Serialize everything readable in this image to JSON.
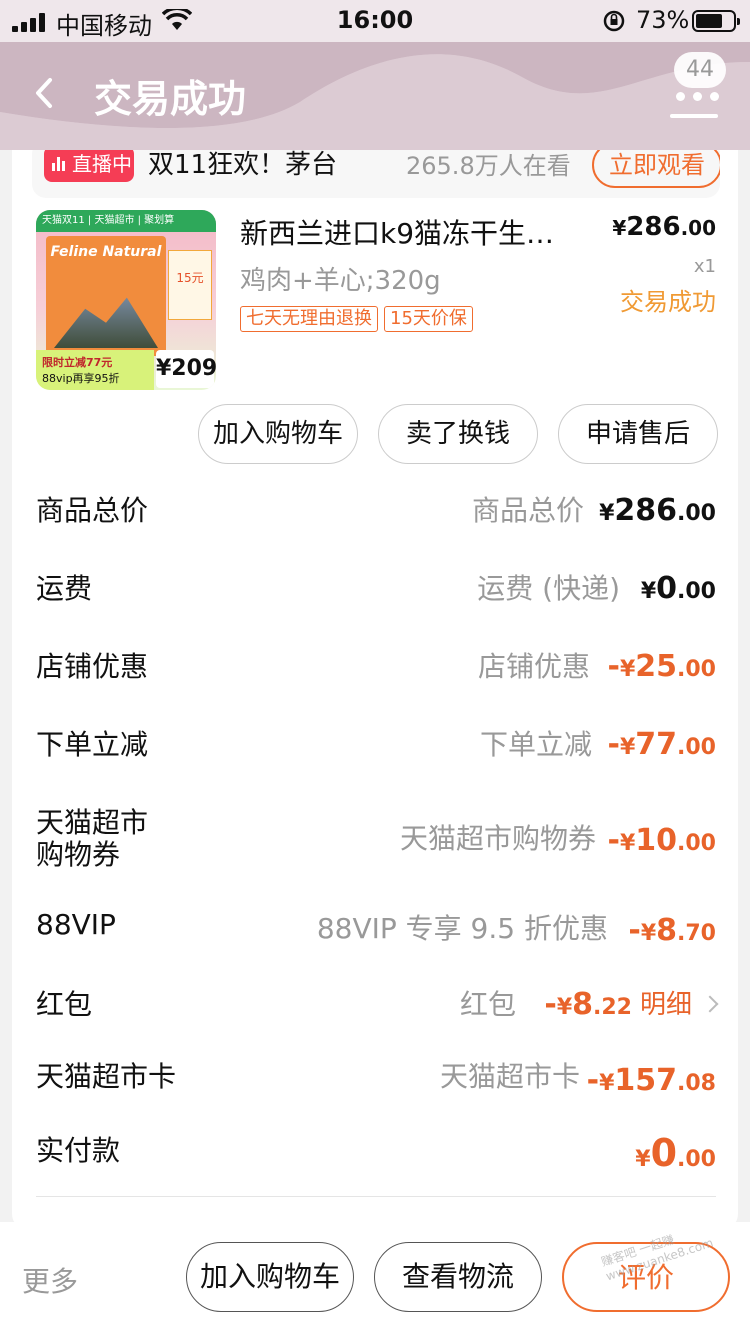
{
  "status_bar": {
    "carrier": "中国移动",
    "time": "16:00",
    "battery_percent": "73%",
    "battery_level": 0.73
  },
  "header": {
    "title": "交易成功",
    "badge_count": "44"
  },
  "live": {
    "tag": "直播中",
    "title": "双11狂欢！茅台",
    "viewers": "265.8万人在看",
    "watch_button": "立即观看"
  },
  "product": {
    "name": "新西兰进口k9猫冻干生…",
    "price_currency": "¥",
    "price_int": "286",
    "price_dec": ".00",
    "spec": "鸡肉+羊心;320g",
    "quantity": "x1",
    "status": "交易成功",
    "tags": [
      "七天无理由退换",
      "15天价保"
    ],
    "thumbnail": {
      "banner": "天猫双11 | 天猫超市 | 聚划算",
      "brand": "Feline Natural",
      "coupon": "15元",
      "offer_line1": "限时立减77元",
      "offer_line2": "88vip再享95折",
      "price": "¥209"
    }
  },
  "item_actions": [
    "加入购物车",
    "卖了换钱",
    "申请售后"
  ],
  "price_rows": [
    {
      "label": "商品总价",
      "sub": "商品总价",
      "prefix": "",
      "currency": "¥",
      "int": "286",
      "dec": ".00",
      "color": "black"
    },
    {
      "label": "运费",
      "sub": "运费 (快递)",
      "prefix": "",
      "currency": "¥",
      "int": "0",
      "dec": ".00",
      "color": "black"
    },
    {
      "label": "店铺优惠",
      "sub": "店铺优惠",
      "prefix": "-",
      "currency": "¥",
      "int": "25",
      "dec": ".00",
      "color": "orange"
    },
    {
      "label": "下单立减",
      "sub": "下单立减",
      "prefix": "-",
      "currency": "¥",
      "int": "77",
      "dec": ".00",
      "color": "orange"
    },
    {
      "label": "天猫超市",
      "label2": "购物券",
      "sub": "天猫超市购物券",
      "prefix": "-",
      "currency": "¥",
      "int": "10",
      "dec": ".00",
      "color": "orange"
    },
    {
      "label": "88VIP",
      "sub": "88VIP 专享 9.5 折优惠",
      "prefix": "-",
      "currency": "¥",
      "int": "8",
      "dec": ".70",
      "color": "orange"
    },
    {
      "label": "红包",
      "sub": "红包",
      "prefix": "-",
      "currency": "¥",
      "int": "8",
      "dec": ".22",
      "color": "orange",
      "link": "明细"
    },
    {
      "label": "天猫超市卡",
      "sub": "天猫超市卡",
      "prefix": "-",
      "currency": "¥",
      "int": "157",
      "dec": ".08",
      "color": "orange"
    },
    {
      "label": "实付款",
      "sub": "",
      "prefix": "",
      "currency": "¥",
      "int": "0",
      "dec": ".00",
      "color": "orange"
    }
  ],
  "bottom_bar": {
    "more": "更多",
    "add_to_cart": "加入购物车",
    "view_logistics": "查看物流",
    "review": "评价"
  },
  "watermark": "赚客吧 一起赚 www.zuanke8.com",
  "colors": {
    "accent": "#f06d2f",
    "discount": "#e8632a",
    "header_bg": "#d9c7d0",
    "live_red": "#f53d55",
    "status_yellow": "#f09a34"
  }
}
